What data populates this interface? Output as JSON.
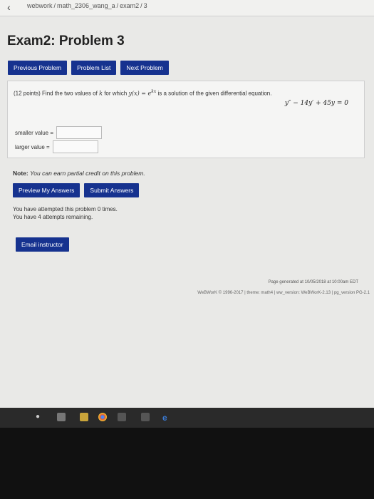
{
  "breadcrumb": {
    "items": [
      "webwork",
      "math_2306_wang_a",
      "exam2",
      "3"
    ],
    "separator": "/"
  },
  "page": {
    "title": "Exam2: Problem 3"
  },
  "nav_buttons": {
    "previous": "Previous Problem",
    "list": "Problem List",
    "next": "Next Problem"
  },
  "problem": {
    "points": "(12 points)",
    "text_a": "Find the two values of",
    "var_k": "k",
    "text_b": "for which",
    "y_of_x": "y(x) = e",
    "exponent": "kx",
    "text_c": "is a solution of the given differential equation.",
    "equation": "y″ − 14y′ + 45y = 0"
  },
  "fields": {
    "smaller_label": "smaller value =",
    "smaller_value": "",
    "larger_label": "larger value =",
    "larger_value": ""
  },
  "note": {
    "label": "Note:",
    "text": "You can earn partial credit on this problem."
  },
  "actions": {
    "preview": "Preview My Answers",
    "submit": "Submit Answers"
  },
  "attempts": {
    "line1": "You have attempted this problem 0 times.",
    "line2": "You have 4 attempts remaining."
  },
  "email": {
    "label": "Email instructor"
  },
  "footer": {
    "generated": "Page generated at 10/05/2018 at 10:00am EDT",
    "copyright": "WeBWorK © 1996-2017 | theme: math4 | ww_version: WeBWorK-2.13 | pg_version PG-2.1"
  },
  "taskbar_icons": [
    "microphone-icon",
    "keyboard-icon",
    "folder-icon",
    "chrome-icon",
    "grid-icon",
    "app-icon",
    "edge-icon"
  ],
  "colors": {
    "button": "#16328f",
    "background": "#e9e9e7"
  }
}
